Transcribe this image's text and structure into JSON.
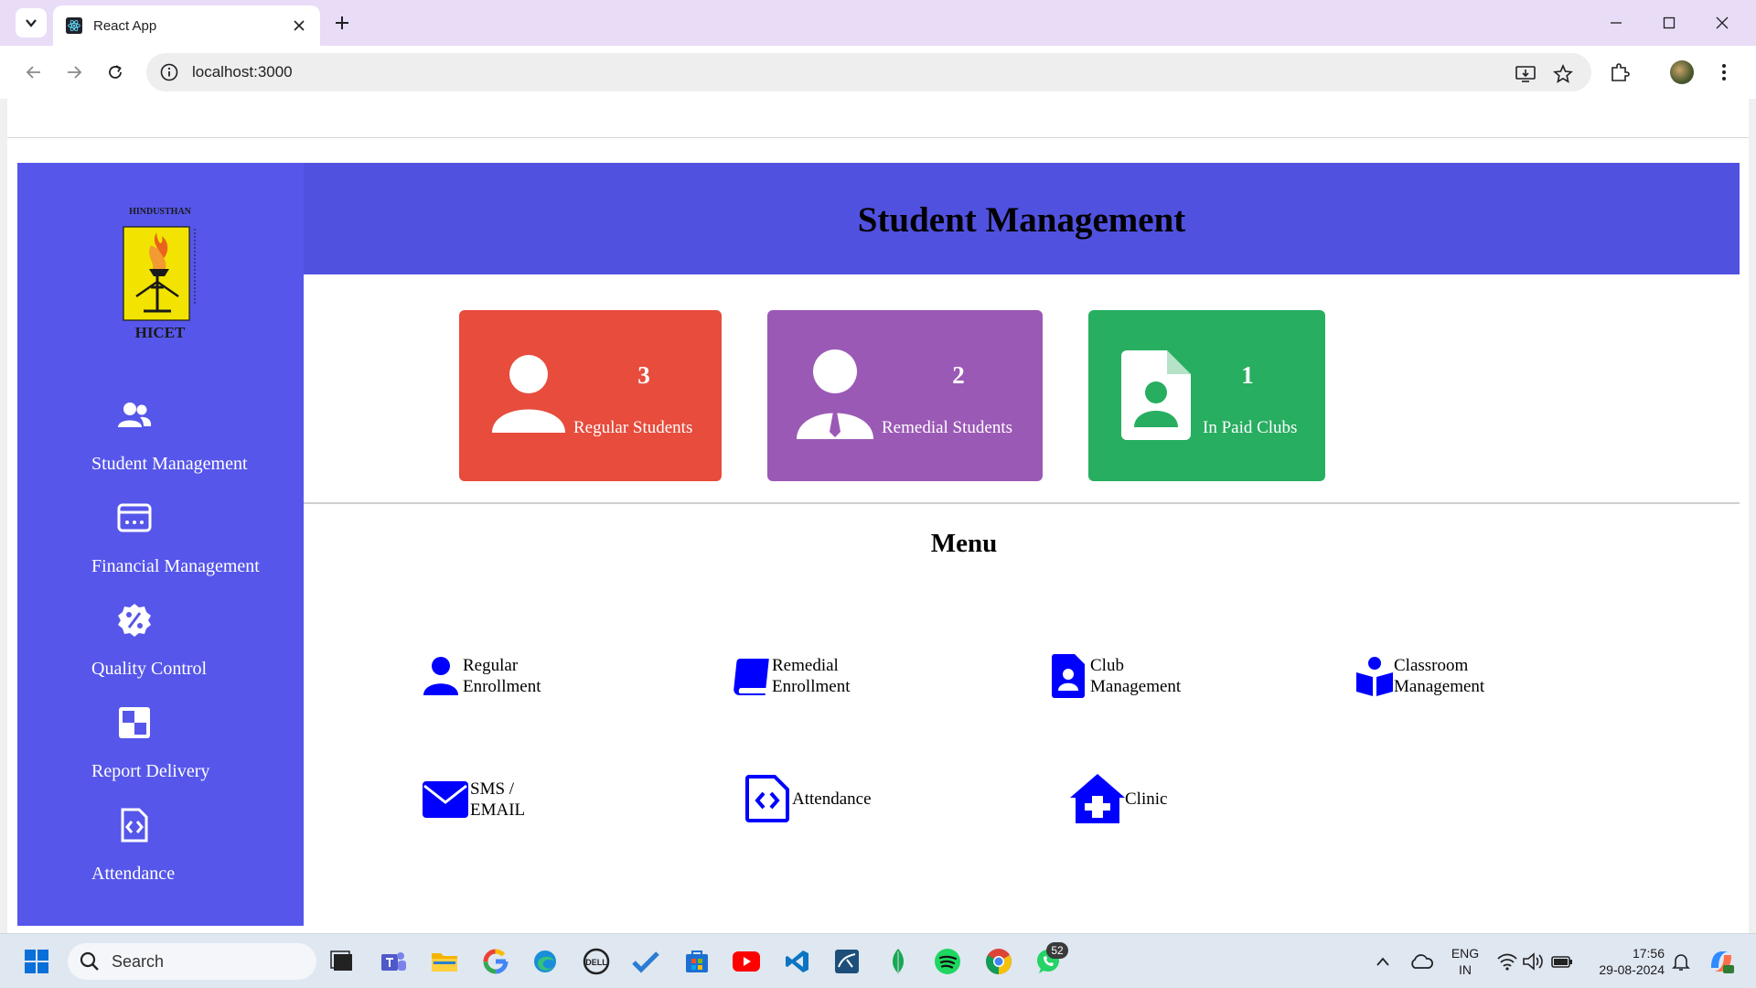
{
  "browser": {
    "tab_title": "React App",
    "url": "localhost:3000"
  },
  "sidebar": {
    "logo_text": "HICET",
    "logo_arc_text": "HINDUSTHAN",
    "items": [
      {
        "label": "Student Management",
        "icon": "users-icon"
      },
      {
        "label": "Financial Management",
        "icon": "card-icon"
      },
      {
        "label": "Quality Control",
        "icon": "percent-badge-icon"
      },
      {
        "label": "Report Delivery",
        "icon": "checker-icon"
      },
      {
        "label": "Attendance",
        "icon": "file-code-icon"
      }
    ]
  },
  "header": {
    "title": "Student Management"
  },
  "cards": [
    {
      "count": "3",
      "label": "Regular Students",
      "color": "#e74c3c",
      "icon": "user-icon"
    },
    {
      "count": "2",
      "label": "Remedial Students",
      "color": "#9b59b6",
      "icon": "user-tie-icon"
    },
    {
      "count": "1",
      "label": "In Paid Clubs",
      "color": "#27ae60",
      "icon": "file-user-icon"
    }
  ],
  "menu": {
    "title": "Menu",
    "items": [
      {
        "line1": "Regular",
        "line2": "Enrollment",
        "icon": "user-icon"
      },
      {
        "line1": "Remedial",
        "line2": "Enrollment",
        "icon": "book-icon"
      },
      {
        "line1": "Club",
        "line2": "Management",
        "icon": "file-user-icon"
      },
      {
        "line1": "Classroom",
        "line2": "Management",
        "icon": "book-reader-icon"
      },
      {
        "line1": "SMS /",
        "line2": "EMAIL",
        "icon": "envelope-icon"
      },
      {
        "line1": "Attendance",
        "line2": "",
        "icon": "file-code-icon"
      },
      {
        "line1": "Clinic",
        "line2": "",
        "icon": "house-medical-icon"
      }
    ],
    "icon_color": "#0000ff"
  },
  "taskbar": {
    "search_placeholder": "Search",
    "lang_top": "ENG",
    "lang_bottom": "IN",
    "time": "17:56",
    "date": "29-08-2024",
    "whatsapp_badge": "52"
  },
  "colors": {
    "sidebar_bg": "#5656ea",
    "header_bg": "#5151e0",
    "tabbar_bg": "#e9dcf7"
  }
}
